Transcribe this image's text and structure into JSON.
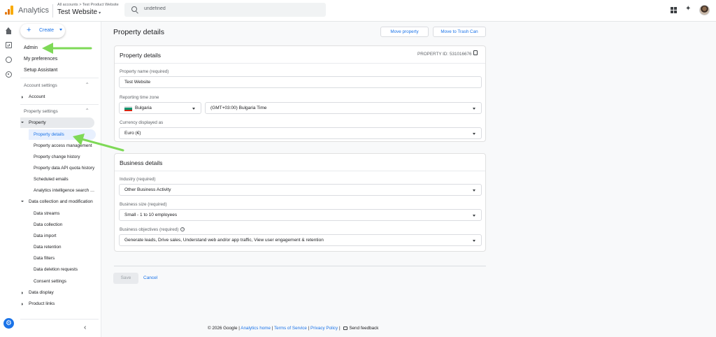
{
  "header": {
    "app_name": "Analytics",
    "breadcrumb_root": "All accounts",
    "breadcrumb_sep": ">",
    "breadcrumb_account": "Test Product Website",
    "property_name": "Test Website",
    "search_value": "undefined",
    "property_caret": "▾"
  },
  "sidebar": {
    "create_label": "Create",
    "admin": "Admin",
    "my_preferences": "My preferences",
    "setup_assistant": "Setup Assistant",
    "account_settings": "Account settings",
    "account": "Account",
    "property_settings": "Property settings",
    "property": "Property",
    "property_items": [
      "Property details",
      "Property access management",
      "Property change history",
      "Property data API quota history",
      "Scheduled emails",
      "Analytics intelligence search history"
    ],
    "data_collection": "Data collection and modification",
    "data_items": [
      "Data streams",
      "Data collection",
      "Data import",
      "Data retention",
      "Data filters",
      "Data deletion requests",
      "Consent settings"
    ],
    "data_display": "Data display",
    "product_links": "Product links"
  },
  "main": {
    "title": "Property details",
    "move_property": "Move property",
    "move_to_trash": "Move to Trash Can",
    "property_card": {
      "title": "Property details",
      "property_id": "PROPERTY ID: 531016676",
      "property_name_label": "Property name (required)",
      "property_name_value": "Test Website",
      "timezone_label": "Reporting time zone",
      "country_value": "Bulgaria",
      "timezone_value": "(GMT+03:00) Bulgaria Time",
      "currency_label": "Currency displayed as",
      "currency_value": "Euro (€)"
    },
    "business_card": {
      "title": "Business details",
      "industry_label": "Industry (required)",
      "industry_value": "Other Business Activity",
      "size_label": "Business size (required)",
      "size_value": "Small - 1 to 10 employees",
      "objectives_label": "Business objectives (required)",
      "objectives_value": "Generate leads, Drive sales, Understand web and/or app traffic, View user engagement & retention"
    },
    "save": "Save",
    "cancel": "Cancel"
  },
  "footer": {
    "copyright": "© 2026 Google |",
    "analytics_home": "Analytics home",
    "sep1": "|",
    "terms": "Terms of Service",
    "sep2": "|",
    "privacy": "Privacy Policy",
    "sep3": "|",
    "feedback": "Send feedback"
  },
  "colors": {
    "accent": "#1a73e8",
    "annotation_arrow": "#7ed957",
    "selected_bg": "#e8f0fe"
  },
  "icons": [
    "analytics-logo-icon",
    "search-icon",
    "apps-grid-icon",
    "sparkle-icon",
    "home-icon",
    "reports-icon",
    "explore-icon",
    "advertising-icon",
    "settings-gear-icon",
    "copy-icon",
    "help-icon",
    "feedback-icon"
  ]
}
